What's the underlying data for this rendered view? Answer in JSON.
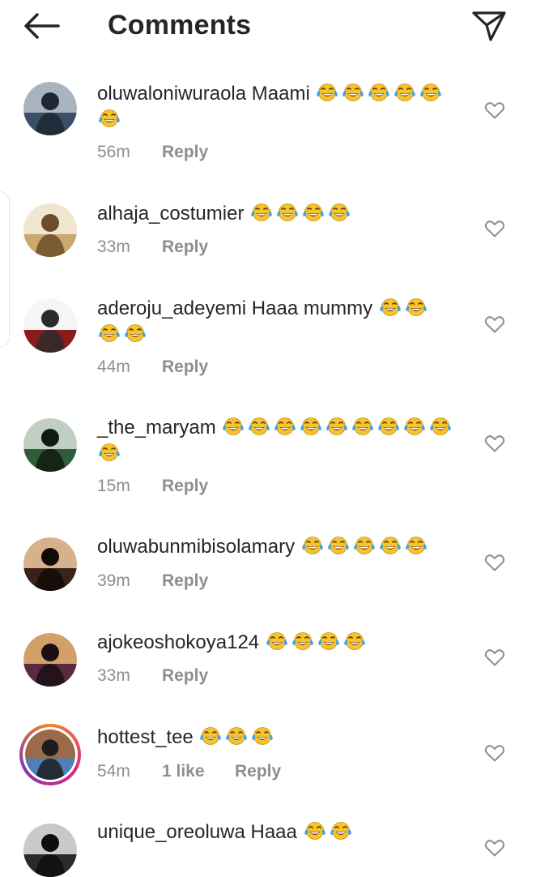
{
  "header": {
    "title": "Comments"
  },
  "comments": [
    {
      "username": "oluwaloniwuraola",
      "text": "Maami",
      "emojis_line1": 5,
      "emojis_line2": 1,
      "time": "56m",
      "likes": "",
      "reply": "Reply"
    },
    {
      "username": "alhaja_costumier",
      "text": "",
      "emojis_line1": 4,
      "emojis_line2": 0,
      "time": "33m",
      "likes": "",
      "reply": "Reply"
    },
    {
      "username": "aderoju_adeyemi",
      "text": "Haaa mummy",
      "emojis_line1": 2,
      "emojis_line2": 2,
      "time": "44m",
      "likes": "",
      "reply": "Reply"
    },
    {
      "username": "_the_maryam",
      "text": "",
      "emojis_line1": 9,
      "emojis_line2": 1,
      "time": "15m",
      "likes": "",
      "reply": "Reply"
    },
    {
      "username": "oluwabunmibisolamary",
      "text": "",
      "emojis_line1": 5,
      "emojis_line2": 0,
      "time": "39m",
      "likes": "",
      "reply": "Reply"
    },
    {
      "username": "ajokeoshokoya124",
      "text": "",
      "emojis_line1": 4,
      "emojis_line2": 0,
      "time": "33m",
      "likes": "",
      "reply": "Reply"
    },
    {
      "username": "hottest_tee",
      "text": "",
      "emojis_line1": 3,
      "emojis_line2": 0,
      "time": "54m",
      "likes": "1 like",
      "reply": "Reply"
    },
    {
      "username": "unique_oreoluwa",
      "text": "Haaa",
      "emojis_line1": 2,
      "emojis_line2": 0,
      "time": "",
      "likes": "",
      "reply": ""
    }
  ],
  "icons": {
    "back": "arrow-left-icon",
    "send": "paper-plane-icon",
    "heart": "heart-outline-icon",
    "emoji": "face-with-tears-of-joy"
  },
  "colors": {
    "text": "#262626",
    "meta": "#8e8e8e",
    "emoji_face": "#f5c32b",
    "tears": "#3da2e8",
    "story_ring": "#e1306c"
  }
}
